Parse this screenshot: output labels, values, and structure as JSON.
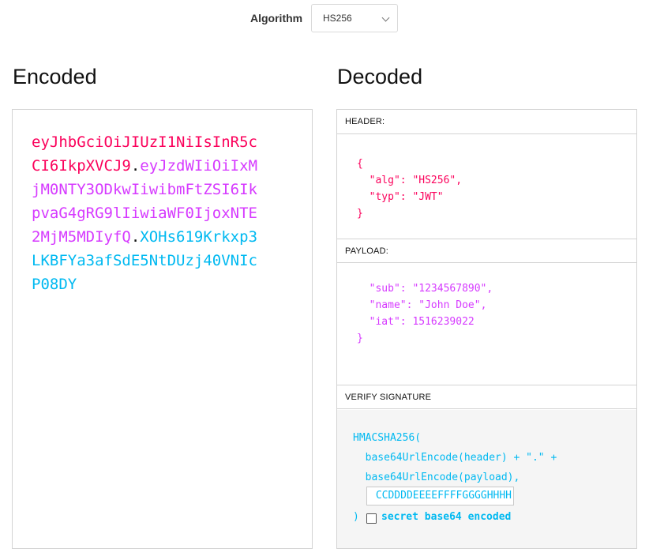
{
  "algorithm": {
    "label": "Algorithm",
    "selected": "HS256"
  },
  "encoded": {
    "title": "Encoded",
    "header_part": "eyJhbGciOiJIUzI1NiIsInR5cCI6IkpXVCJ9",
    "payload_part": "eyJzdWIiOiIxMjM0NTY3ODkwIiwibmFtZSI6IkpvaG4gRG9lIiwiaWF0IjoxNTE2MjM5MDIyfQ",
    "signature_part": "XOHs619Krkxp3LKBFYa3afSdE5NtDUzj40VNIcP08DY",
    "separator": "."
  },
  "decoded": {
    "title": "Decoded",
    "header": {
      "label": "HEADER:",
      "open": "{",
      "alg_key": "\"alg\"",
      "alg_val": "\"HS256\"",
      "typ_key": "\"typ\"",
      "typ_val": "\"JWT\"",
      "close": "}"
    },
    "payload": {
      "label": "PAYLOAD:",
      "sub_key": "\"sub\"",
      "sub_val": "\"1234567890\"",
      "name_key": "\"name\"",
      "name_val": "\"John Doe\"",
      "iat_key": "\"iat\"",
      "iat_val": "1516239022",
      "close": "}"
    },
    "verify": {
      "label": "VERIFY SIGNATURE",
      "fn": "HMACSHA256(",
      "line1": "base64UrlEncode(header) + \".\" +",
      "line2": "base64UrlEncode(payload),",
      "secret_value": "CCDDDDEEEEFFFFGGGGHHHH",
      "close_paren": ")",
      "checkbox_label": "secret base64 encoded"
    }
  }
}
